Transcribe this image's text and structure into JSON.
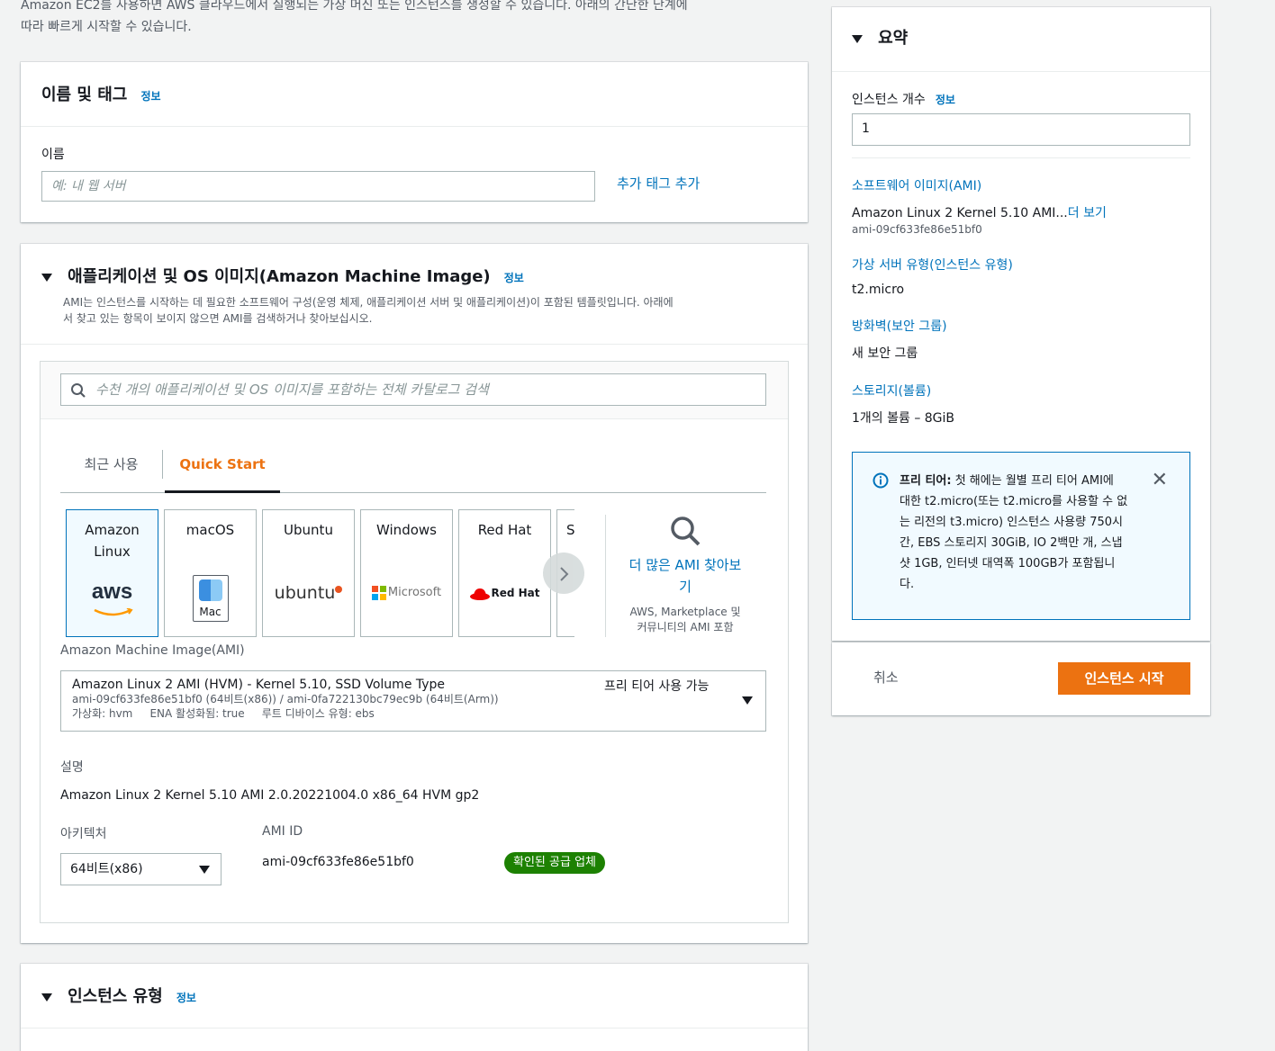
{
  "intro": {
    "line1": "Amazon EC2를 사용하면 AWS 클라우드에서 실행되는 가상 머신 또는 인스턴스를 생성할 수 있습니다. 아래의 간단한 단계에",
    "line2": "따라 빠르게 시작할 수 있습니다."
  },
  "name_tags": {
    "title": "이름 및 태그",
    "info": "정보",
    "name_label": "이름",
    "name_placeholder": "예: 내 웹 서버",
    "add_tag": "추가 태그 추가"
  },
  "ami": {
    "title": "애플리케이션 및 OS 이미지(Amazon Machine Image)",
    "info": "정보",
    "desc1": "AMI는 인스턴스를 시작하는 데 필요한 소프트웨어 구성(운영 체제, 애플리케이션 서버 및 애플리케이션)이 포함된 템플릿입니다. 아래에",
    "desc2": "서 찾고 있는 항목이 보이지 않으면 AMI를 검색하거나 찾아보십시오.",
    "search_placeholder": "수천 개의 애플리케이션 및 OS 이미지를 포함하는 전체 카탈로그 검색",
    "tabs": [
      {
        "label": "최근 사용"
      },
      {
        "label": "Quick Start"
      }
    ],
    "tiles": [
      {
        "line1": "Amazon",
        "line2": "Linux",
        "logo": "aws"
      },
      {
        "line1": "macOS",
        "logo": "Mac"
      },
      {
        "line1": "Ubuntu",
        "logo": "ubuntu"
      },
      {
        "line1": "Windows",
        "logo": "Microsoft"
      },
      {
        "line1": "Red Hat",
        "logo": "Red Hat"
      },
      {
        "line1": "S"
      }
    ],
    "more_link1": "더 많은 AMI 찾아보",
    "more_link2": "기",
    "more_sub1": "AWS, Marketplace 및",
    "more_sub2": "커뮤니티의 AMI 포함",
    "ami_label": "Amazon Machine Image(AMI)",
    "selected": {
      "name": "Amazon Linux 2 AMI (HVM) - Kernel 5.10, SSD Volume Type",
      "ids": "ami-09cf633fe86e51bf0 (64비트(x86)) / ami-0fa722130bc79ec9b (64비트(Arm))",
      "attrs": "가상화: hvm     ENA 활성화됨: true     루트 디바이스 유형: ebs",
      "free": "프리 티어 사용 가능"
    },
    "desc_label": "설명",
    "desc_value": "Amazon Linux 2 Kernel 5.10 AMI 2.0.20221004.0 x86_64 HVM gp2",
    "arch_label": "아키텍처",
    "arch_value": "64비트(x86)",
    "amiid_label": "AMI ID",
    "amiid_value": "ami-09cf633fe86e51bf0",
    "verified_badge": "확인된 공급 업체"
  },
  "instance_type": {
    "title": "인스턴스 유형",
    "info": "정보"
  },
  "summary": {
    "title": "요약",
    "count_label": "인스턴스 개수",
    "info": "정보",
    "count_value": "1",
    "ami_link": "소프트웨어 이미지(AMI)",
    "ami_value": "Amazon Linux 2 Kernel 5.10 AMI...",
    "ami_more": "더 보기",
    "ami_id": "ami-09cf633fe86e51bf0",
    "type_link": "가상 서버 유형(인스턴스 유형)",
    "type_value": "t2.micro",
    "fw_link": "방화벽(보안 그룹)",
    "fw_value": "새 보안 그룹",
    "storage_link": "스토리지(볼륨)",
    "storage_value": "1개의 볼륨 – 8GiB",
    "alert_bold": "프리 티어:",
    "alert_l1": " 첫 해에는 월별 프리 티어 AMI에",
    "alert_l2": "대한 t2.micro(또는 t2.micro를 사용할 수 없",
    "alert_l3": "는 리전의 t3.micro) 인스턴스 사용량 750시",
    "alert_l4": "간, EBS 스토리지 30GiB, IO 2백만 개, 스냅",
    "alert_l5": "샷 1GB, 인터넷 대역폭 100GB가 포함됩니",
    "alert_l6": "다.",
    "cancel": "취소",
    "launch": "인스턴스 시작"
  },
  "colors": {
    "accent": "#ec7211",
    "link": "#0073bb",
    "success": "#1d8102"
  }
}
